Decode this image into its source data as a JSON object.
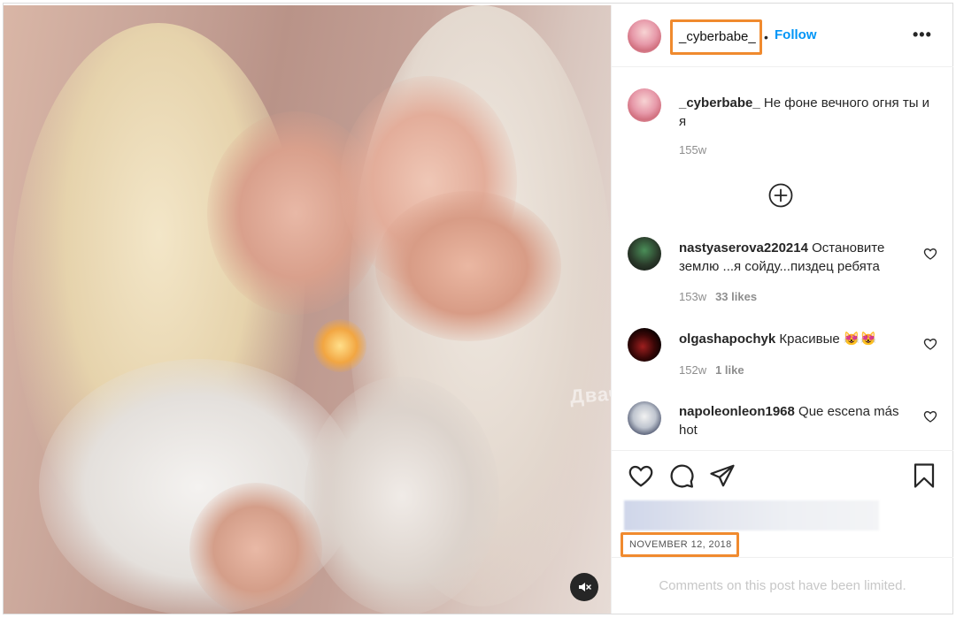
{
  "post": {
    "username": "_cyberbabe_",
    "follow_label": "Follow",
    "dot": "•",
    "more_label": "•••",
    "caption_user": "_cyberbabe_",
    "caption_text": "Не фоне вечного огня ты и я",
    "caption_age": "155w",
    "watermark": "Двач",
    "date": "NOVEMBER 12, 2018",
    "comments_limited": "Comments on this post have been limited."
  },
  "comments": [
    {
      "user": "nastyaserova220214",
      "text": "Остановите землю ...я сойду...пиздец ребята",
      "age": "153w",
      "likes": "33 likes"
    },
    {
      "user": "olgashapochyk",
      "text": "Красивые 😻😻",
      "age": "152w",
      "likes": "1 like"
    },
    {
      "user": "napoleonleon1968",
      "text": "Que escena más hot"
    }
  ],
  "colors": {
    "accent": "#0095f6",
    "highlight": "#f08a2e",
    "text": "#262626",
    "muted": "#8e8e8e"
  },
  "icons": [
    "like-icon",
    "comment-icon",
    "share-icon",
    "save-icon",
    "mute-icon",
    "add-comments-icon",
    "more-options-icon"
  ]
}
